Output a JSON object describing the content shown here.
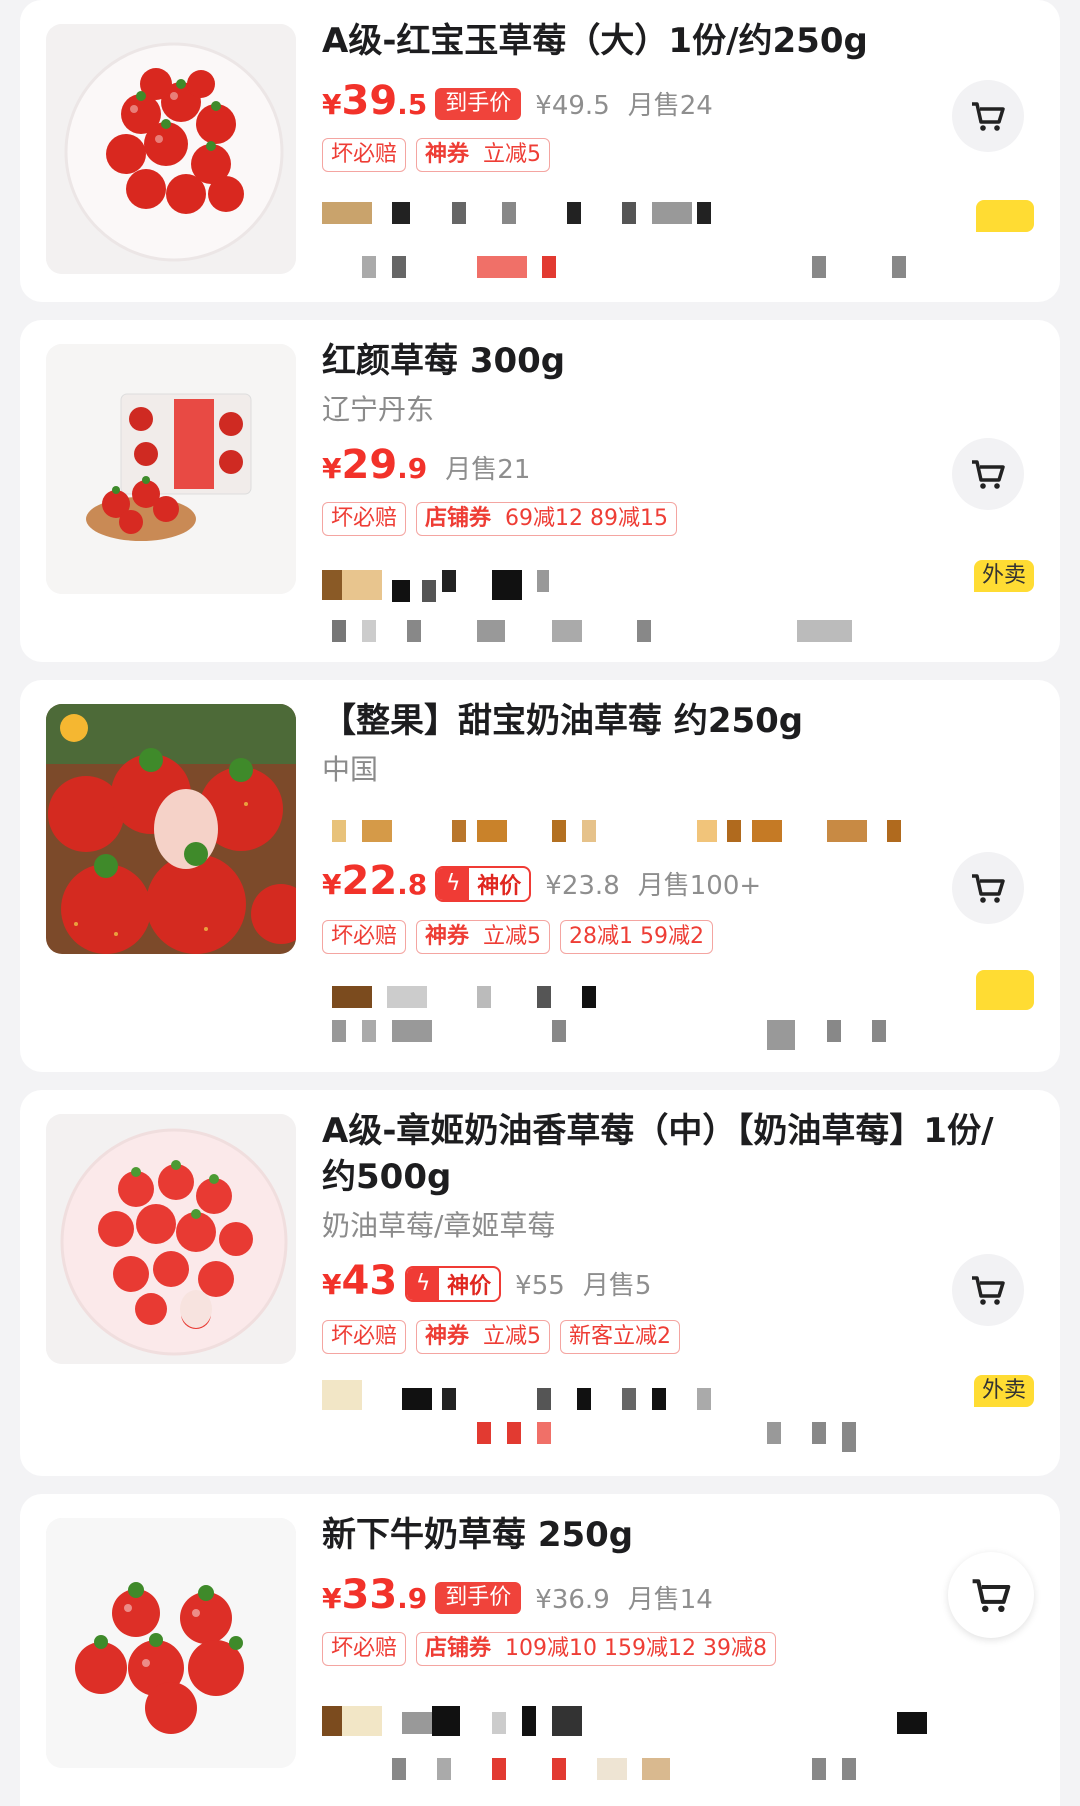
{
  "products": [
    {
      "title": "A级-红宝玉草莓（大）1份/约250g",
      "origin": "",
      "price_int": "39",
      "price_dec": ".5",
      "price_tag": "到手价",
      "orig_price": "¥49.5",
      "sold": "月售24",
      "badges": [
        "坏必赔"
      ],
      "coupon": {
        "strong": "神券",
        "text": "立减5"
      },
      "takeout": ""
    },
    {
      "title": "红颜草莓 300g",
      "origin": "辽宁丹东",
      "price_int": "29",
      "price_dec": ".9",
      "price_tag": "",
      "orig_price": "",
      "sold": "月售21",
      "badges": [
        "坏必赔"
      ],
      "coupon": {
        "strong": "店铺券",
        "text": "69减12  89减15"
      },
      "takeout": "外卖"
    },
    {
      "title": "【整果】甜宝奶油草莓 约250g",
      "origin": "中国",
      "price_int": "22",
      "price_dec": ".8",
      "price_tag": "神价",
      "orig_price": "¥23.8",
      "sold": "月售100+",
      "badges": [
        "坏必赔"
      ],
      "coupon": {
        "strong": "神券",
        "text": "立减5"
      },
      "extra": "28减1  59减2",
      "takeout": ""
    },
    {
      "title": "A级-章姬奶油香草莓（中）【奶油草莓】1份/约500g",
      "origin": "奶油草莓/章姬草莓",
      "price_int": "43",
      "price_dec": "",
      "price_tag": "神价",
      "orig_price": "¥55",
      "sold": "月售5",
      "badges": [
        "坏必赔"
      ],
      "coupon": {
        "strong": "神券",
        "text": "立减5"
      },
      "extra": "新客立减2",
      "takeout": "外卖"
    },
    {
      "title": "新下牛奶草莓 250g",
      "origin": "",
      "price_int": "33",
      "price_dec": ".9",
      "price_tag": "到手价",
      "orig_price": "¥36.9",
      "sold": "月售14",
      "badges": [
        "坏必赔"
      ],
      "coupon": {
        "strong": "店铺券",
        "text": "109减10  159减12  39减8"
      },
      "takeout": ""
    }
  ],
  "currency": "¥",
  "colors": {
    "price": "#f2322a",
    "tag_border": "#f4a5a1",
    "takeout_bg": "#ffdc33"
  },
  "icons": {
    "cart": "cart-icon",
    "flash": "lightning-icon"
  }
}
